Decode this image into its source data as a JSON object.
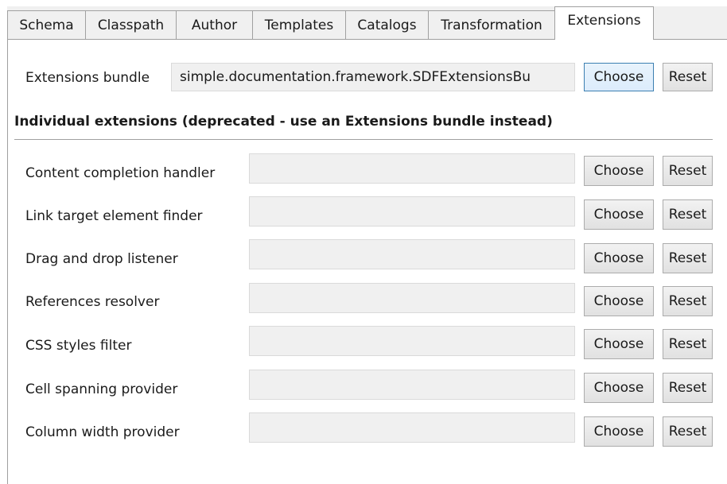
{
  "tabs": [
    {
      "label": "Schema"
    },
    {
      "label": "Classpath"
    },
    {
      "label": "Author"
    },
    {
      "label": "Templates"
    },
    {
      "label": "Catalogs"
    },
    {
      "label": "Transformation"
    },
    {
      "label": "Extensions"
    }
  ],
  "active_tab": "Extensions",
  "bundle": {
    "label": "Extensions bundle",
    "value": "simple.documentation.framework.SDFExtensionsBu",
    "choose_label": "Choose",
    "reset_label": "Reset"
  },
  "section_heading": "Individual extensions (deprecated - use an Extensions bundle instead)",
  "extensions": [
    {
      "label": "Content completion handler",
      "value": "",
      "choose_label": "Choose",
      "reset_label": "Reset"
    },
    {
      "label": "Link target element finder",
      "value": "",
      "choose_label": "Choose",
      "reset_label": "Reset"
    },
    {
      "label": "Drag and drop listener",
      "value": "",
      "choose_label": "Choose",
      "reset_label": "Reset"
    },
    {
      "label": "References resolver",
      "value": "",
      "choose_label": "Choose",
      "reset_label": "Reset"
    },
    {
      "label": "CSS styles filter",
      "value": "",
      "choose_label": "Choose",
      "reset_label": "Reset"
    },
    {
      "label": "Cell spanning provider",
      "value": "",
      "choose_label": "Choose",
      "reset_label": "Reset"
    },
    {
      "label": "Column width provider",
      "value": "",
      "choose_label": "Choose",
      "reset_label": "Reset"
    }
  ]
}
